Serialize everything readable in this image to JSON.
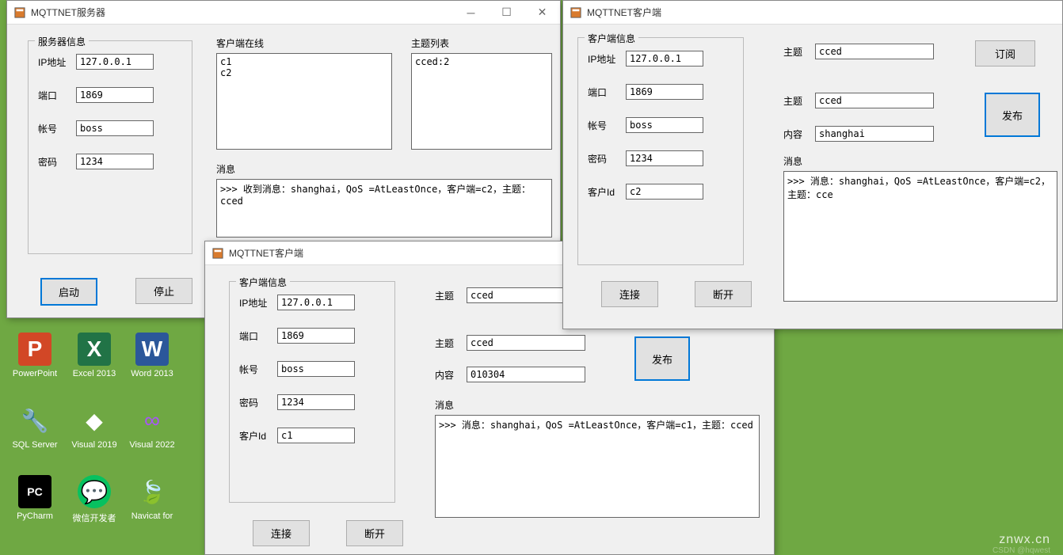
{
  "desktop": {
    "icons": [
      {
        "label": "PowerPoint",
        "letter": "P",
        "bg": "#d24726"
      },
      {
        "label": "Excel 2013",
        "letter": "X",
        "bg": "#217346"
      },
      {
        "label": "Word 2013",
        "letter": "W",
        "bg": "#2b579a"
      },
      {
        "label": "SQL Server",
        "letter": "🔧",
        "bg": "#f5c518"
      },
      {
        "label": "Visual 2019",
        "letter": "◆",
        "bg": "#fff"
      },
      {
        "label": "Visual 2022",
        "letter": "∞",
        "bg": "#a855f7"
      },
      {
        "label": "PyCharm",
        "letter": "PC",
        "bg": "#000"
      },
      {
        "label": "微信开发者",
        "letter": "💬",
        "bg": "#07c160"
      },
      {
        "label": "Navicat for",
        "letter": "🍃",
        "bg": "#2bb24c"
      }
    ],
    "watermark": "znwx.cn",
    "watermark_sub": "CSDN @hqwest"
  },
  "server_window": {
    "title": "MQTTNET服务器",
    "group_title": "服务器信息",
    "labels": {
      "ip": "IP地址",
      "port": "端口",
      "user": "帐号",
      "pass": "密码"
    },
    "fields": {
      "ip": "127.0.0.1",
      "port": "1869",
      "user": "boss",
      "pass": "1234"
    },
    "online_label": "客户端在线",
    "online_text": "c1\nc2",
    "topics_label": "主题列表",
    "topics_text": "cced:2",
    "msg_label": "消息",
    "msg_text": ">>> 收到消息：shanghai，QoS =AtLeastOnce，客户端=c2，主题：cced",
    "start_btn": "启动",
    "stop_btn": "停止"
  },
  "client1_window": {
    "title": "MQTTNET客户端",
    "group_title": "客户端信息",
    "labels": {
      "ip": "IP地址",
      "port": "端口",
      "user": "帐号",
      "pass": "密码",
      "cid": "客户Id",
      "topic": "主题",
      "content": "内容"
    },
    "fields": {
      "ip": "127.0.0.1",
      "port": "1869",
      "user": "boss",
      "pass": "1234",
      "cid": "c1",
      "sub_topic": "cced",
      "pub_topic": "cced",
      "content": "010304"
    },
    "msg_label": "消息",
    "msg_text": ">>> 消息：shanghai，QoS =AtLeastOnce，客户端=c1，主题：cced",
    "connect_btn": "连接",
    "disconnect_btn": "断开",
    "sub_btn": "订阅",
    "pub_btn": "发布"
  },
  "client2_window": {
    "title": "MQTTNET客户端",
    "group_title": "客户端信息",
    "labels": {
      "ip": "IP地址",
      "port": "端口",
      "user": "帐号",
      "pass": "密码",
      "cid": "客户Id",
      "topic": "主题",
      "content": "内容"
    },
    "fields": {
      "ip": "127.0.0.1",
      "port": "1869",
      "user": "boss",
      "pass": "1234",
      "cid": "c2",
      "sub_topic": "cced",
      "pub_topic": "cced",
      "content": "shanghai"
    },
    "msg_label": "消息",
    "msg_text": ">>> 消息：shanghai，QoS =AtLeastOnce，客户端=c2，主题：cce",
    "connect_btn": "连接",
    "disconnect_btn": "断开",
    "sub_btn": "订阅",
    "pub_btn": "发布"
  }
}
